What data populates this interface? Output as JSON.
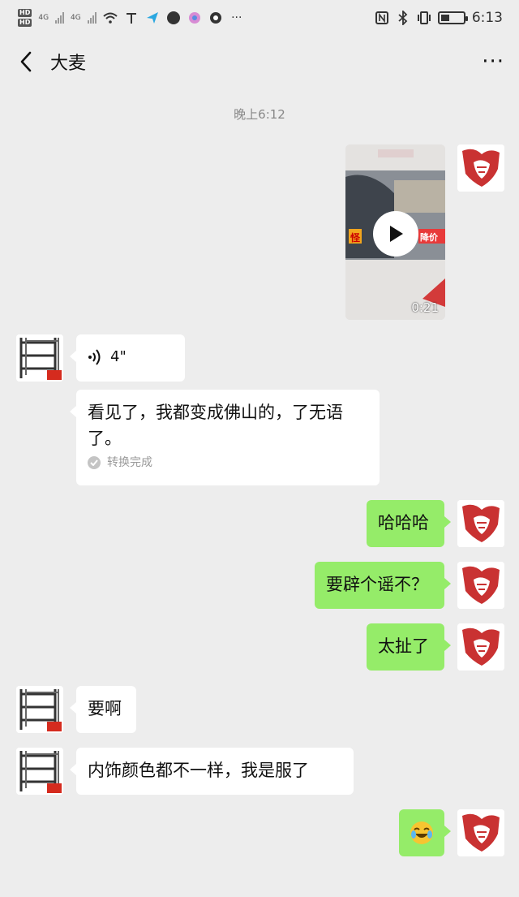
{
  "status_bar": {
    "hd1": "HD",
    "hd2": "HD",
    "net1": "4G",
    "net2": "4G",
    "time": "6:13"
  },
  "header": {
    "title": "大麦",
    "more": "···"
  },
  "timestamp": "晚上6:12",
  "video": {
    "duration": "0:21",
    "banner_left": "怪",
    "banner_right": "降价"
  },
  "voice": {
    "duration": "4\"",
    "transcript": "看见了，我都变成佛山的，了无语了。",
    "status": "转换完成"
  },
  "messages": {
    "m1": "哈哈哈",
    "m2": "要辟个谣不？",
    "m3": "太扯了",
    "m4": "要啊",
    "m5": "内饰颜色都不一样，我是服了"
  },
  "colors": {
    "bg": "#ededed",
    "sent_bubble": "#95ec69",
    "received_bubble": "#ffffff"
  }
}
